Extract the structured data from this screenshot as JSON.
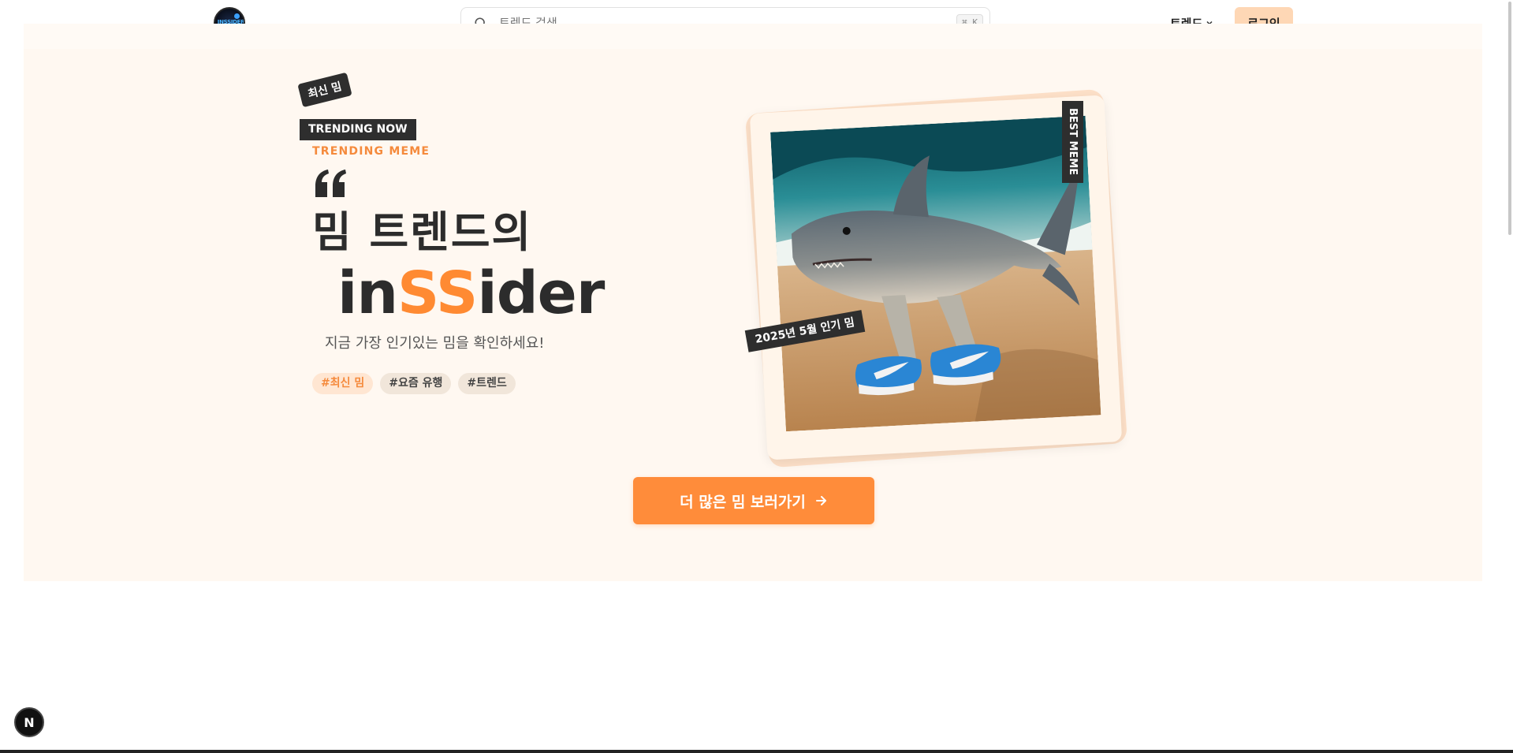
{
  "header": {
    "logo_text": "INSSIDER",
    "search_placeholder": "트렌드 검색...",
    "search_shortcut": "⌘ K",
    "nav_trend_label": "트렌드",
    "login_label": "로그인"
  },
  "hero": {
    "sticker_label": "최신 밈",
    "badge_label": "TRENDING NOW",
    "eyebrow": "TRENDING MEME",
    "headline_line1": "밈 트렌드의",
    "headline_line2_prefix": "in",
    "headline_line2_accent": "SS",
    "headline_line2_suffix": "ider",
    "subtitle": "지금 가장 인기있는 밈을 확인하세요!",
    "tags": [
      "#최신 밈",
      "#요즘 유행",
      "#트렌드"
    ],
    "card_badge_best": "BEST MEME",
    "card_badge_date": "2025년 5월 인기 밈",
    "cta_label": "더 많은 밈 보러가기"
  },
  "fab_label": "N",
  "colors": {
    "accent": "#ff8c3a",
    "hero_bg": "#fff8f1",
    "dark_badge": "#2e2e2e",
    "login_bg": "#fed7b5"
  },
  "icons": {
    "search": "search-icon",
    "chevron": "chevron-down-icon",
    "quote": "quote-icon",
    "arrow": "arrow-right-icon"
  }
}
